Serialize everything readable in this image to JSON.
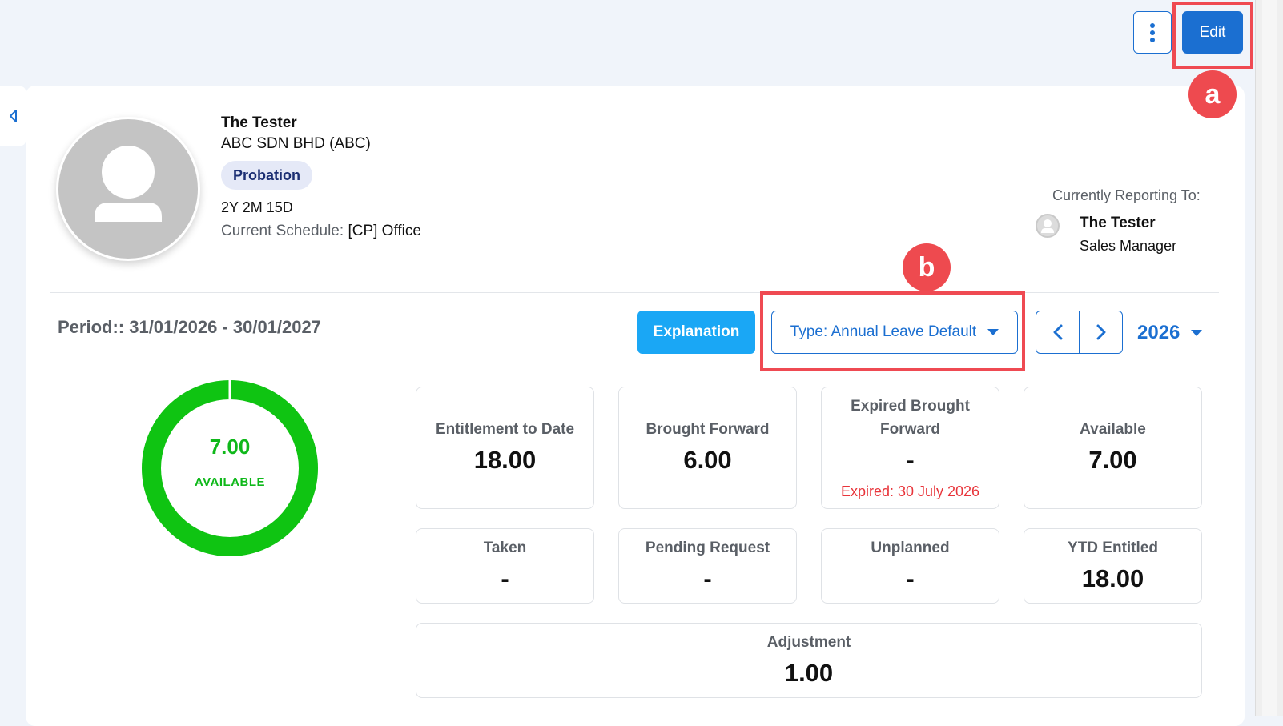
{
  "toolbar": {
    "more_options_icon": "vertical-ellipsis-icon",
    "edit_label": "Edit"
  },
  "annotations": {
    "marker_a": "a",
    "marker_b": "b"
  },
  "employee": {
    "name": "The Tester",
    "company": "ABC SDN BHD (ABC)",
    "status": "Probation",
    "tenure": "2Y 2M 15D",
    "schedule_label": "Current Schedule:",
    "schedule_value": "[CP] Office"
  },
  "reporting": {
    "label": "Currently Reporting To:",
    "manager_name": "The Tester",
    "manager_title": "Sales Manager"
  },
  "leave": {
    "period": "Period:: 31/01/2026 - 30/01/2027",
    "explanation_label": "Explanation",
    "type_label": "Type: Annual Leave Default",
    "year": "2026",
    "donut": {
      "value": "7.00",
      "label": "AVAILABLE",
      "fraction": 1.0,
      "color": "#0fc412"
    },
    "stats": {
      "entitlement": {
        "label": "Entitlement to Date",
        "value": "18.00"
      },
      "brought_forward": {
        "label": "Brought Forward",
        "value": "6.00"
      },
      "expired_bf": {
        "label_line1": "Expired Brought",
        "label_line2": "Forward",
        "value": "-",
        "note": "Expired: 30 July 2026"
      },
      "available": {
        "label": "Available",
        "value": "7.00"
      },
      "taken": {
        "label": "Taken",
        "value": "-"
      },
      "pending": {
        "label": "Pending Request",
        "value": "-"
      },
      "unplanned": {
        "label": "Unplanned",
        "value": "-"
      },
      "ytd_entitled": {
        "label": "YTD Entitled",
        "value": "18.00"
      },
      "adjustment": {
        "label": "Adjustment",
        "value": "1.00"
      }
    }
  },
  "colors": {
    "primary": "#1b6fd1",
    "accent": "#1aa7f5",
    "success": "#0fc412",
    "danger": "#e8343a",
    "highlight": "#ef4a52"
  }
}
